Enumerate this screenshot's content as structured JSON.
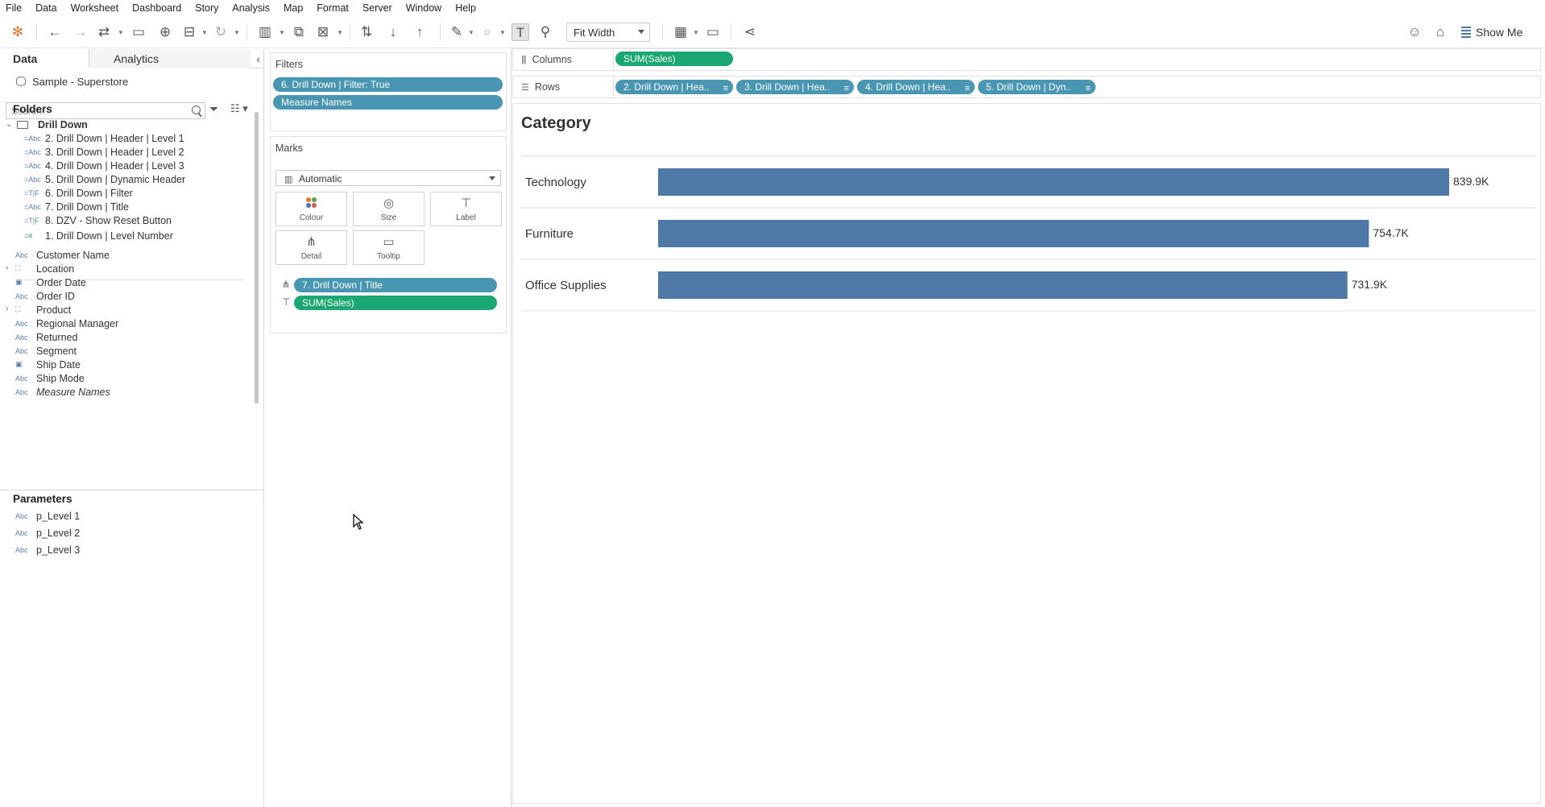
{
  "menu": [
    "File",
    "Data",
    "Worksheet",
    "Dashboard",
    "Story",
    "Analysis",
    "Map",
    "Format",
    "Server",
    "Window",
    "Help"
  ],
  "toolbar": {
    "fit_label": "Fit Width",
    "show_me_label": "Show Me"
  },
  "data_pane": {
    "tabs": [
      "Data",
      "Analytics"
    ],
    "datasource": "Sample - Superstore",
    "search_placeholder": "Search",
    "folders_heading": "Folders",
    "folder_name": "Drill Down",
    "folder_fields": [
      {
        "type": "=Abc",
        "name": "2. Drill Down | Header | Level 1"
      },
      {
        "type": "=Abc",
        "name": "3. Drill Down | Header | Level 2"
      },
      {
        "type": "=Abc",
        "name": "4. Drill Down | Header | Level 3"
      },
      {
        "type": "=Abc",
        "name": "5. Drill Down | Dynamic Header"
      },
      {
        "type": "=T|F",
        "name": "6. Drill Down | Filter"
      },
      {
        "type": "=Abc",
        "name": "7. Drill Down | Title"
      },
      {
        "type": "=T|F",
        "name": "8. DZV - Show Reset Button"
      },
      {
        "type": "=#",
        "name": "1. Drill Down | Level Number"
      }
    ],
    "dimensions": [
      {
        "type": "Abc",
        "name": "Customer Name"
      },
      {
        "type": "hierarchy",
        "name": "Location"
      },
      {
        "type": "date",
        "name": "Order Date"
      },
      {
        "type": "Abc",
        "name": "Order ID"
      },
      {
        "type": "hierarchy",
        "name": "Product"
      },
      {
        "type": "Abc",
        "name": "Regional Manager"
      },
      {
        "type": "Abc",
        "name": "Returned"
      },
      {
        "type": "Abc",
        "name": "Segment"
      },
      {
        "type": "date",
        "name": "Ship Date"
      },
      {
        "type": "Abc",
        "name": "Ship Mode"
      },
      {
        "type": "Abc",
        "name": "Measure Names"
      }
    ],
    "parameters_heading": "Parameters",
    "parameters": [
      {
        "type": "Abc",
        "name": "p_Level 1"
      },
      {
        "type": "Abc",
        "name": "p_Level 2"
      },
      {
        "type": "Abc",
        "name": "p_Level 3"
      }
    ]
  },
  "filters": {
    "title": "Filters",
    "pills": [
      "6. Drill Down | Filter: True",
      "Measure Names"
    ]
  },
  "marks": {
    "title": "Marks",
    "type": "Automatic",
    "buttons": [
      "Colour",
      "Size",
      "Label",
      "Detail",
      "Tooltip"
    ],
    "encodings": [
      "7. Drill Down | Title",
      "SUM(Sales)"
    ]
  },
  "shelves": {
    "columns_label": "Columns",
    "columns_pills": [
      "SUM(Sales)"
    ],
    "rows_label": "Rows",
    "rows_pills": [
      "2. Drill Down | Hea..",
      "3. Drill Down | Hea..",
      "4. Drill Down | Hea..",
      "5. Drill Down | Dyn.."
    ]
  },
  "view": {
    "title": "Category"
  },
  "chart_data": {
    "type": "bar",
    "orientation": "horizontal",
    "title": "Category",
    "categories": [
      "Technology",
      "Furniture",
      "Office Supplies"
    ],
    "values": [
      839.9,
      754.7,
      731.9
    ],
    "value_labels": [
      "839.9K",
      "754.7K",
      "731.9K"
    ],
    "unit": "K",
    "bar_color": "#4e79a7",
    "xlim": [
      0,
      880
    ],
    "grid": false
  },
  "colors": {
    "pill_blue": "#4996b2",
    "pill_green": "#1aa774",
    "bar": "#4e79a7",
    "brand_show_me": "#4e79a7"
  }
}
